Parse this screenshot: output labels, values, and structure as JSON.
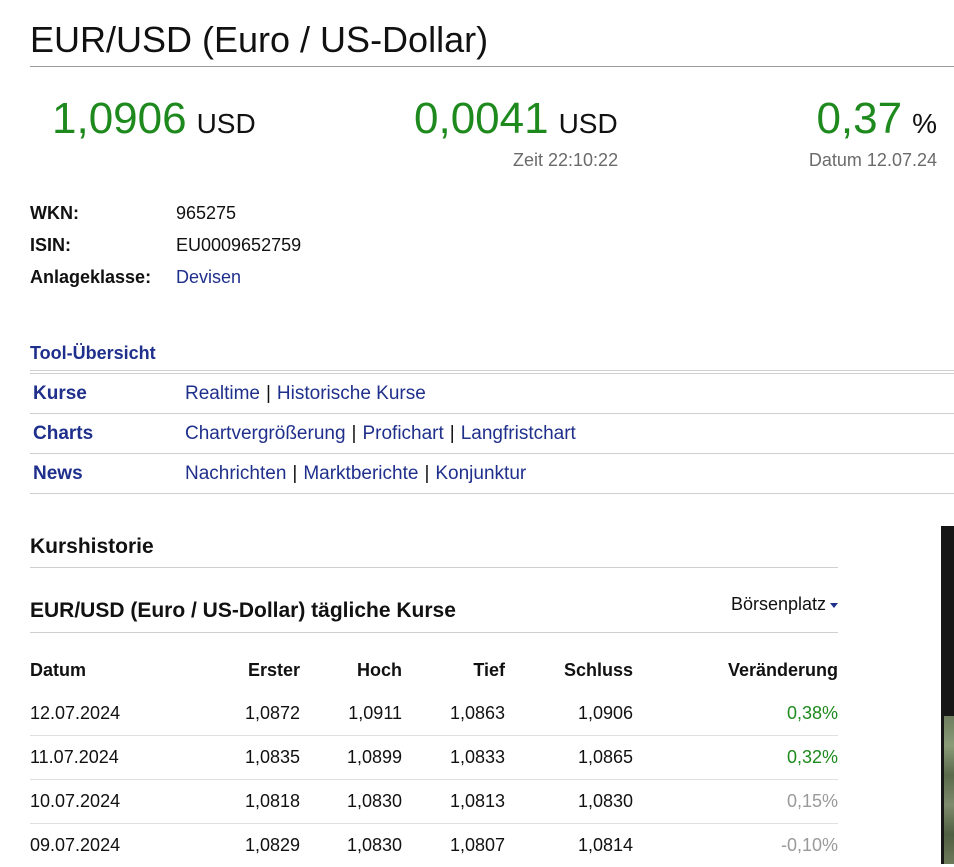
{
  "header": {
    "title": "EUR/USD (Euro / US-Dollar)"
  },
  "quote": {
    "price": "1,0906",
    "price_unit": "USD",
    "change": "0,0041",
    "change_unit": "USD",
    "change_pct": "0,37",
    "change_pct_unit": "%",
    "time_label": "Zeit 22:10:22",
    "date_label": "Datum 12.07.24"
  },
  "info": [
    {
      "label": "WKN:",
      "value": "965275"
    },
    {
      "label": "ISIN:",
      "value": "EU0009652759"
    },
    {
      "label": "Anlageklasse:",
      "value": "Devisen"
    }
  ],
  "tools": {
    "title": "Tool-Übersicht",
    "rows": [
      {
        "label": "Kurse",
        "links": [
          "Realtime",
          "Historische Kurse"
        ]
      },
      {
        "label": "Charts",
        "links": [
          "Chartvergrößerung",
          "Profichart",
          "Langfristchart"
        ]
      },
      {
        "label": "News",
        "links": [
          "Nachrichten",
          "Marktberichte",
          "Konjunktur"
        ]
      }
    ],
    "separator": "|"
  },
  "history": {
    "section_title": "Kurshistorie",
    "table_title": "EUR/USD (Euro / US-Dollar) tägliche Kurse",
    "exchange_dropdown": "Börsenplatz",
    "columns": [
      "Datum",
      "Erster",
      "Hoch",
      "Tief",
      "Schluss",
      "Veränderung"
    ],
    "rows": [
      [
        "12.07.2024",
        "1,0872",
        "1,0911",
        "1,0863",
        "1,0906",
        "0,38%"
      ],
      [
        "11.07.2024",
        "1,0835",
        "1,0899",
        "1,0833",
        "1,0865",
        "0,32%"
      ],
      [
        "10.07.2024",
        "1,0818",
        "1,0830",
        "1,0813",
        "1,0830",
        "0,15%"
      ],
      [
        "09.07.2024",
        "1,0829",
        "1,0830",
        "1,0807",
        "1,0814",
        "-0,10%"
      ]
    ]
  },
  "colors": {
    "positive": "#1e8a1e",
    "link": "#1f2f8c",
    "muted": "#9a9a9a"
  }
}
